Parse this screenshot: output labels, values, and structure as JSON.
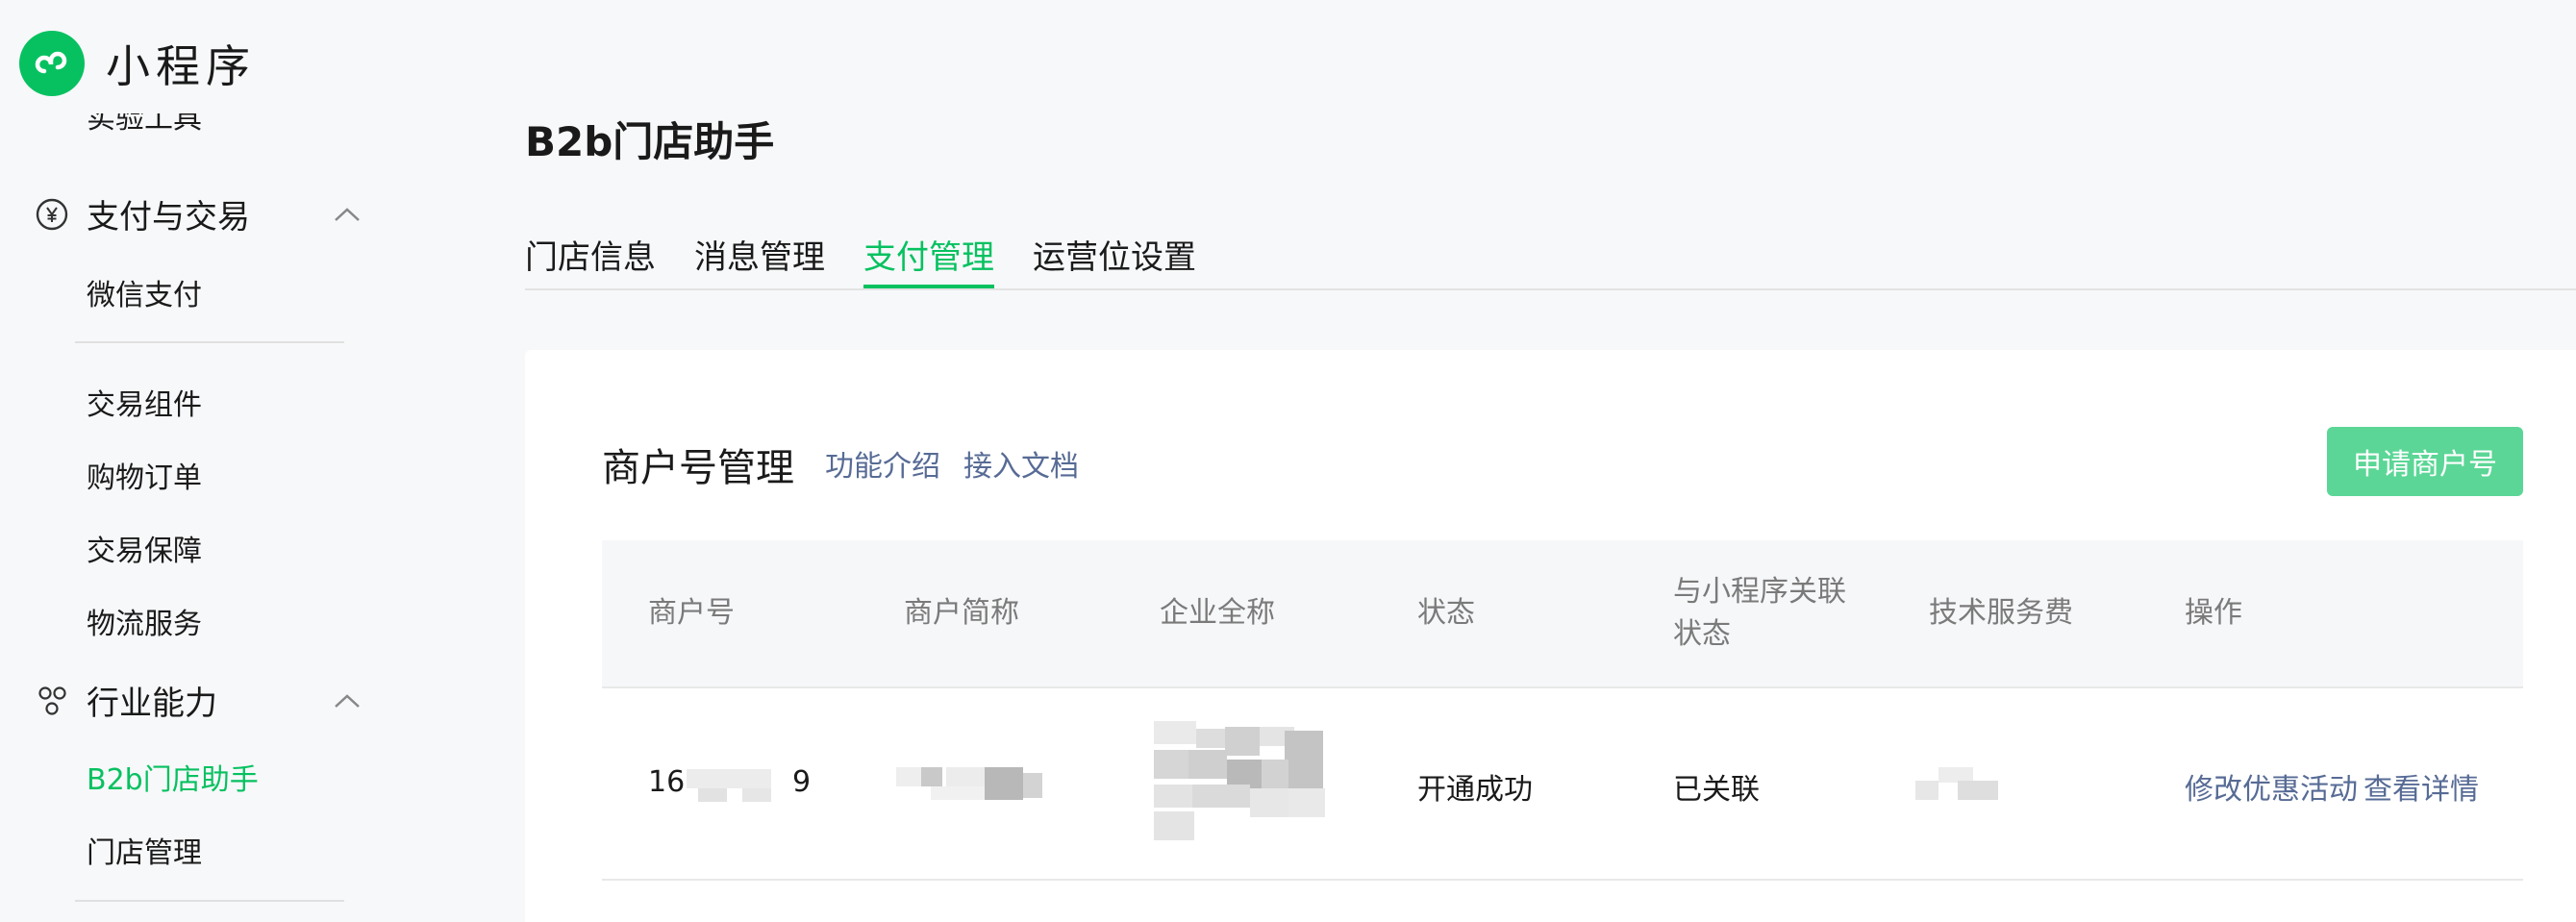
{
  "brand": {
    "name": "小程序",
    "logo_icon": "mini-program-logo-icon"
  },
  "sidebar": {
    "cut_item": "实验工具",
    "sections": [
      {
        "label": "支付与交易",
        "icon": "yuan-circle-icon",
        "expanded": true
      },
      {
        "label": "行业能力",
        "icon": "industry-nodes-icon",
        "expanded": true
      }
    ],
    "items": [
      {
        "label": "微信支付"
      },
      {
        "label": "交易组件"
      },
      {
        "label": "购物订单"
      },
      {
        "label": "交易保障"
      },
      {
        "label": "物流服务"
      },
      {
        "label": "B2b门店助手",
        "active": true
      },
      {
        "label": "门店管理"
      }
    ]
  },
  "page": {
    "title": "B2b门店助手"
  },
  "tabs": [
    {
      "label": "门店信息"
    },
    {
      "label": "消息管理"
    },
    {
      "label": "支付管理",
      "active": true
    },
    {
      "label": "运营位设置"
    }
  ],
  "card": {
    "title": "商户号管理",
    "links": [
      "功能介绍",
      "接入文档"
    ],
    "apply_button": "申请商户号"
  },
  "table": {
    "headers": [
      "商户号",
      "商户简称",
      "企业全称",
      "状态",
      "与小程序关联",
      "状态",
      "技术服务费",
      "操作"
    ],
    "row": {
      "merchant_id_prefix": "16",
      "merchant_id_suffix": "9",
      "status": "开通成功",
      "link_status": "已关联",
      "actions": [
        "修改优惠活动",
        "查看详情"
      ]
    }
  },
  "colors": {
    "accent": "#07c160",
    "link": "#576b95",
    "text": "#1a1a1a",
    "muted": "#7a7a7a"
  }
}
